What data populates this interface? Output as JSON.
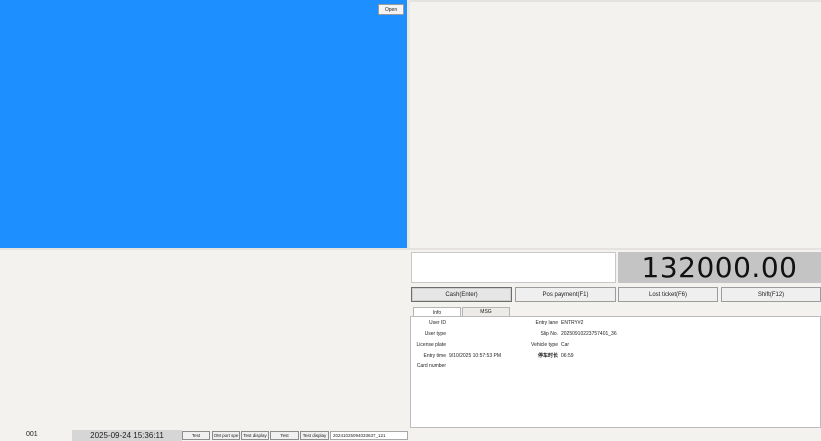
{
  "camera": {
    "open_label": "Open",
    "background": "#1e8fff"
  },
  "payment": {
    "amount": "132000.00",
    "input_value": ""
  },
  "actions": {
    "cash": "Cash(Enter)",
    "pos": "Pos payment(F1)",
    "lost": "Lost ticket(F6)",
    "shift": "Shift(F12)"
  },
  "tabs": {
    "info": "Info",
    "msg": "MSG"
  },
  "info": {
    "user_id_label": "User ID",
    "user_id_value": "",
    "user_type_label": "User type",
    "user_type_value": "",
    "license_plate_label": "License plate",
    "license_plate_value": "",
    "entry_time_label": "Entry time",
    "entry_time_value": "9/10/2025 10:57:53 PM",
    "card_number_label": "Card number",
    "card_number_value": "",
    "entry_lane_label": "Entry lane",
    "entry_lane_value": "ENTRY#2",
    "slip_no_label": "Slip No.",
    "slip_no_value": "2025091022375740​1_36",
    "vehicle_type_label": "Vehicle type",
    "vehicle_type_value": "Car",
    "duration_label": "停车时长",
    "duration_value": "06:59"
  },
  "status": {
    "lane": "001",
    "datetime": "2025-09-24 15:36:11",
    "btn_test1": "Test",
    "btn_om": "OM port spe",
    "btn_test_display1": "Test display",
    "btn_test2": "Test",
    "btn_test_display2": "Test display",
    "serial": "2024102509403​3637_121"
  }
}
